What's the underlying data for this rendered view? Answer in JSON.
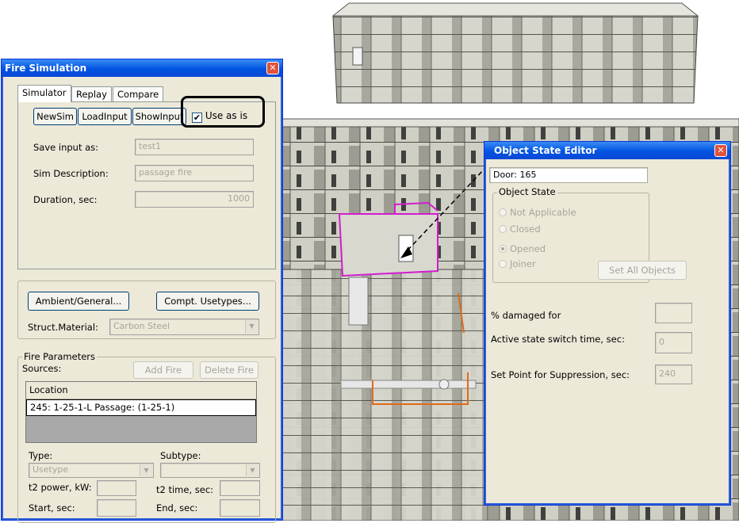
{
  "fire_window": {
    "title": "Fire Simulation",
    "close_glyph": "✕",
    "tabs": [
      "Simulator",
      "Replay",
      "Compare"
    ],
    "buttons": {
      "newsim": "NewSim",
      "loadinput": "LoadInput",
      "showinput": "ShowInput"
    },
    "use_as_is": {
      "label": "Use as is",
      "checked": true
    },
    "save_input_label": "Save input as:",
    "save_input_value": "test1",
    "sim_description_label": "Sim Description:",
    "sim_description_value": "passage fire",
    "duration_label": "Duration, sec:",
    "duration_value": "1000",
    "ambient_button": "Ambient/General...",
    "compt_button": "Compt. Usetypes...",
    "struct_material_label": "Struct.Material:",
    "struct_material_value": "Carbon Steel",
    "fire_params_label": "Fire Parameters",
    "sources_label": "Sources:",
    "add_fire": "Add Fire",
    "delete_fire": "Delete Fire",
    "location_header": "Location",
    "location_row": "245: 1-25-1-L Passage: (1-25-1)",
    "type_label": "Type:",
    "type_value": "Usetype",
    "subtype_label": "Subtype:",
    "subtype_value": "",
    "t2_power_label": "t2 power, kW:",
    "t2_time_label": "t2 time, sec:",
    "start_label": "Start, sec:",
    "end_label": "End, sec:"
  },
  "object_window": {
    "title": "Object State Editor",
    "close_glyph": "✕",
    "door_value": "Door: 165",
    "object_state_label": "Object State",
    "options": [
      "Not Applicable",
      "Closed",
      "Opened",
      "Joiner"
    ],
    "selected": "Opened",
    "set_all_button": "Set All Objects",
    "damaged_label": "% damaged for",
    "damaged_value": "",
    "switch_time_label": "Active state switch time, sec:",
    "switch_time_value": "0",
    "suppression_label": "Set Point for Suppression, sec:",
    "suppression_value": "240"
  },
  "colors": {
    "titlebar": "#0a49d6",
    "highlight_box": "#000000",
    "door_outline": "#d21ccf",
    "pipe_orange": "#e06a1a"
  }
}
